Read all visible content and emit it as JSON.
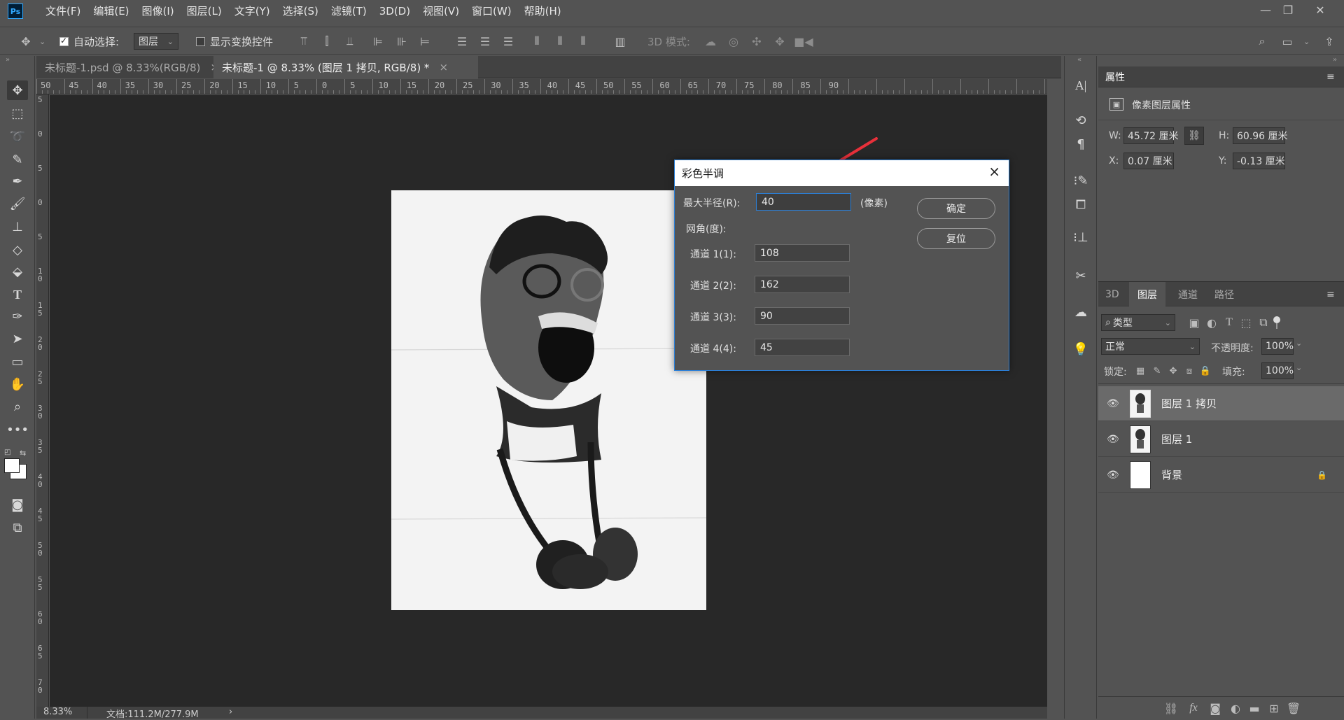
{
  "app": {
    "logo": "Ps"
  },
  "menu": [
    "文件(F)",
    "编辑(E)",
    "图像(I)",
    "图层(L)",
    "文字(Y)",
    "选择(S)",
    "滤镜(T)",
    "3D(D)",
    "视图(V)",
    "窗口(W)",
    "帮助(H)"
  ],
  "options": {
    "auto_select_label": "自动选择:",
    "auto_select_value": "图层",
    "show_transform_label": "显示变换控件",
    "mode_3d_label": "3D 模式:"
  },
  "tabs": [
    {
      "title": "未标题-1.psd @ 8.33%(RGB/8)",
      "close": "×",
      "active": false
    },
    {
      "title": "未标题-1 @ 8.33% (图层 1 拷贝, RGB/8) *",
      "close": "×",
      "active": true
    }
  ],
  "ruler": {
    "top": [
      "50",
      "45",
      "40",
      "35",
      "30",
      "25",
      "20",
      "15",
      "10",
      "5",
      "0",
      "5",
      "10",
      "15",
      "20",
      "25",
      "30",
      "35",
      "40",
      "45",
      "50",
      "55",
      "60",
      "65",
      "70",
      "75",
      "80",
      "85",
      "90"
    ],
    "left": [
      "5",
      "0",
      "5",
      "0",
      "5",
      "1 0",
      "1 5",
      "2 0",
      "2 5",
      "3 0",
      "3 5",
      "4 0",
      "4 5",
      "5 0",
      "5 5",
      "6 0",
      "6 5",
      "7 0"
    ]
  },
  "status": {
    "zoom": "8.33%",
    "doc": "文档:111.2M/277.9M",
    "arrow": "›"
  },
  "dialog": {
    "title": "彩色半调",
    "radius_label": "最大半径(R):",
    "radius_value": "40",
    "radius_unit": "(像素)",
    "angle_label": "网角(度):",
    "channels": [
      {
        "label": "通道 1(1):",
        "value": "108"
      },
      {
        "label": "通道 2(2):",
        "value": "162"
      },
      {
        "label": "通道 3(3):",
        "value": "90"
      },
      {
        "label": "通道 4(4):",
        "value": "45"
      }
    ],
    "ok_label": "确定",
    "reset_label": "复位"
  },
  "properties": {
    "tab": "属性",
    "section": "像素图层属性",
    "w_label": "W:",
    "w_value": "45.72 厘米",
    "h_label": "H:",
    "h_value": "60.96 厘米",
    "x_label": "X:",
    "x_value": "0.07 厘米",
    "y_label": "Y:",
    "y_value": "-0.13 厘米"
  },
  "layers_panel": {
    "tabs": [
      "3D",
      "图层",
      "通道",
      "路径"
    ],
    "active_tab": "图层",
    "filter_label": "类型",
    "blend_mode": "正常",
    "opacity_label": "不透明度:",
    "opacity_value": "100%",
    "lock_label": "锁定:",
    "fill_label": "填充:",
    "fill_value": "100%",
    "layers": [
      {
        "name": "图层 1 拷贝",
        "selected": true,
        "locked": false
      },
      {
        "name": "图层 1",
        "selected": false,
        "locked": false
      },
      {
        "name": "背景",
        "selected": false,
        "locked": true
      }
    ],
    "footer_fx": "fx"
  },
  "colors": {
    "accent": "#2c7fd6",
    "arrow": "#e8303a",
    "canvas_bg": "#282828",
    "panel_bg": "#535353"
  }
}
